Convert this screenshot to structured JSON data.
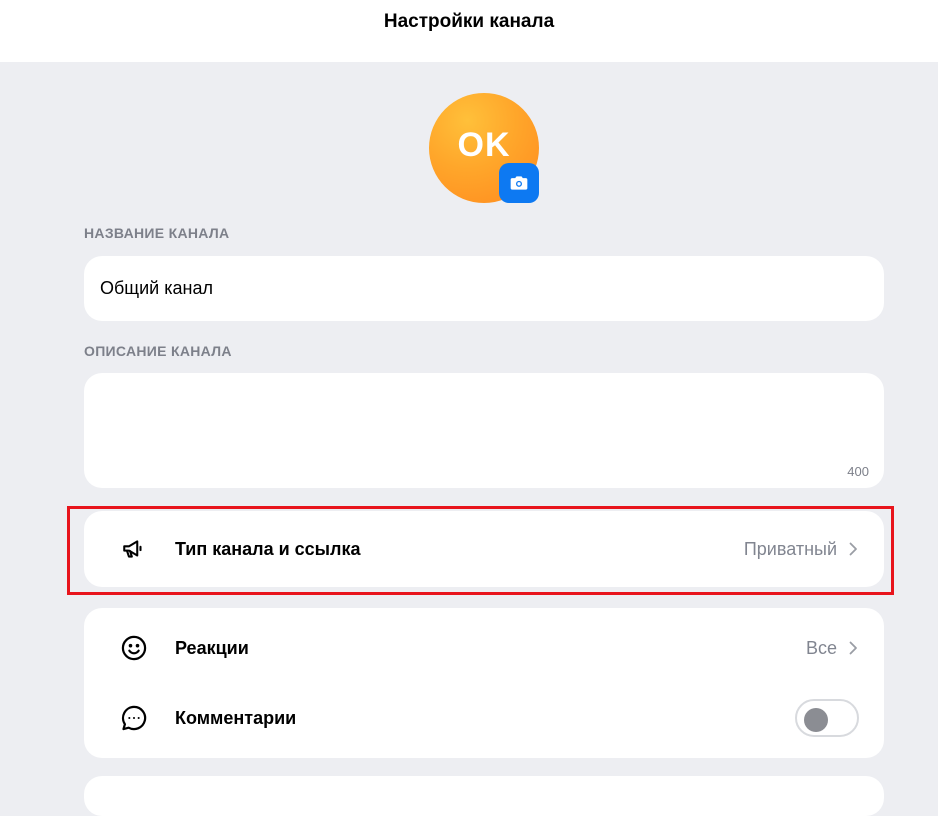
{
  "header": {
    "title": "Настройки канала"
  },
  "avatar": {
    "initials": "OK",
    "gradient_from": "#ffc03a",
    "gradient_to": "#ff8a1f",
    "badge_icon": "camera-icon",
    "badge_color": "#0d79f2"
  },
  "channel_name": {
    "label": "НАЗВАНИЕ КАНАЛА",
    "value": "Общий канал"
  },
  "channel_description": {
    "label": "ОПИСАНИЕ КАНАЛА",
    "value": "",
    "counter": "400"
  },
  "channel_type": {
    "icon": "megaphone-icon",
    "label": "Тип канала и ссылка",
    "value": "Приватный",
    "highlight_color": "#e8141c"
  },
  "reactions": {
    "icon": "smile-icon",
    "label": "Реакции",
    "value": "Все"
  },
  "comments": {
    "icon": "comment-dots-icon",
    "label": "Комментарии",
    "enabled": false
  }
}
